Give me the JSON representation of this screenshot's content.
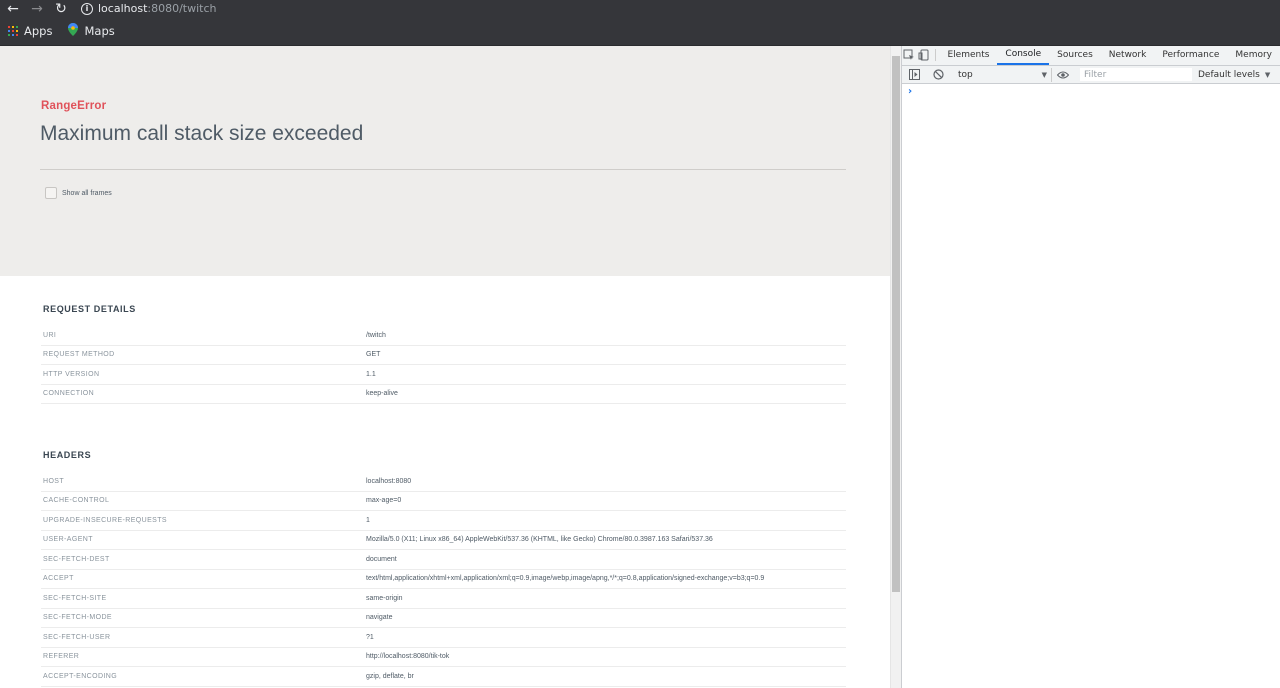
{
  "browser": {
    "url_host": "localhost",
    "url_path": ":8080/twitch",
    "bookmarks": [
      {
        "label": "Apps",
        "icon": "apps-grid-icon"
      },
      {
        "label": "Maps",
        "icon": "maps-pin-icon"
      }
    ]
  },
  "error": {
    "type": "RangeError",
    "message": "Maximum call stack size exceeded",
    "show_frames_label": "Show all frames"
  },
  "request_details": {
    "title": "REQUEST DETAILS",
    "rows": [
      {
        "key": "URI",
        "value": "/twitch"
      },
      {
        "key": "REQUEST METHOD",
        "value": "GET"
      },
      {
        "key": "HTTP VERSION",
        "value": "1.1"
      },
      {
        "key": "CONNECTION",
        "value": "keep-alive"
      }
    ]
  },
  "headers": {
    "title": "HEADERS",
    "rows": [
      {
        "key": "HOST",
        "value": "localhost:8080"
      },
      {
        "key": "CACHE-CONTROL",
        "value": "max-age=0"
      },
      {
        "key": "UPGRADE-INSECURE-REQUESTS",
        "value": "1"
      },
      {
        "key": "USER-AGENT",
        "value": "Mozilla/5.0 (X11; Linux x86_64) AppleWebKit/537.36 (KHTML, like Gecko) Chrome/80.0.3987.163 Safari/537.36"
      },
      {
        "key": "SEC-FETCH-DEST",
        "value": "document"
      },
      {
        "key": "ACCEPT",
        "value": "text/html,application/xhtml+xml,application/xml;q=0.9,image/webp,image/apng,*/*;q=0.8,application/signed-exchange;v=b3;q=0.9"
      },
      {
        "key": "SEC-FETCH-SITE",
        "value": "same-origin"
      },
      {
        "key": "SEC-FETCH-MODE",
        "value": "navigate"
      },
      {
        "key": "SEC-FETCH-USER",
        "value": "?1"
      },
      {
        "key": "REFERER",
        "value": "http://localhost:8080/tik-tok"
      },
      {
        "key": "ACCEPT-ENCODING",
        "value": "gzip, deflate, br"
      }
    ]
  },
  "devtools": {
    "tabs": [
      {
        "label": "Elements",
        "active": false
      },
      {
        "label": "Console",
        "active": true
      },
      {
        "label": "Sources",
        "active": false
      },
      {
        "label": "Network",
        "active": false
      },
      {
        "label": "Performance",
        "active": false
      },
      {
        "label": "Memory",
        "active": false
      }
    ],
    "context": "top",
    "filter_placeholder": "Filter",
    "levels_label": "Default levels",
    "accent_color": "#1a73e8"
  },
  "colors": {
    "error_type": "#e0525a",
    "hero_bg": "#eeedeb",
    "chrome_bg": "#35363a"
  }
}
